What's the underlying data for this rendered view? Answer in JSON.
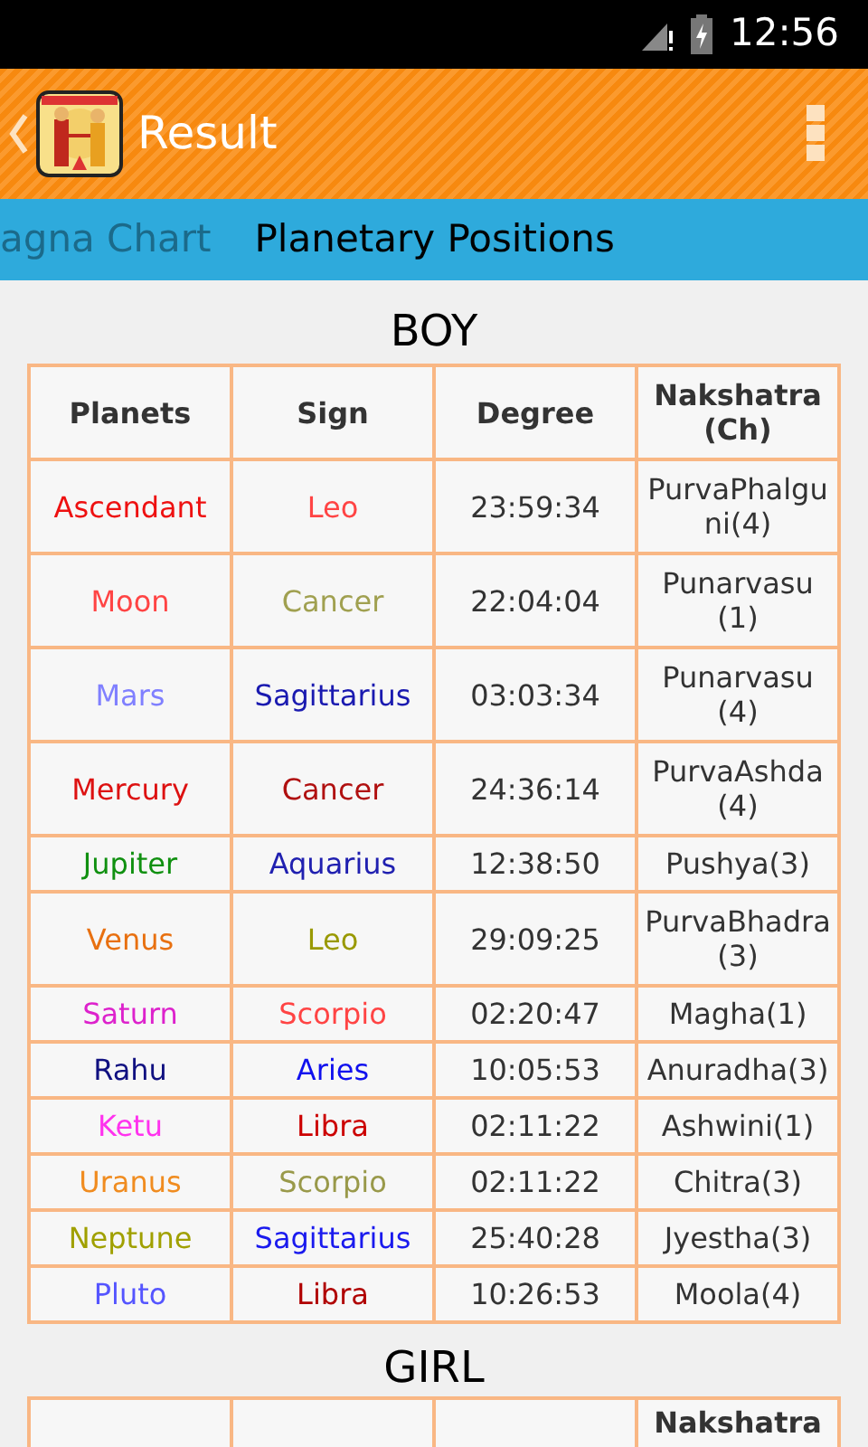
{
  "status_bar": {
    "time": "12:56"
  },
  "toolbar": {
    "title": "Result"
  },
  "tabs": [
    {
      "label": "agna Chart",
      "selected": false
    },
    {
      "label": "Planetary Positions",
      "selected": true
    }
  ],
  "sections": [
    {
      "heading": "BOY",
      "columns": [
        "Planets",
        "Sign",
        "Degree",
        "Nakshatra (Ch)"
      ],
      "rows": [
        {
          "planet": {
            "text": "Ascendant",
            "color": "#ee1111"
          },
          "sign": {
            "text": "Leo",
            "color": "#ff4444"
          },
          "degree": "23:59:34",
          "nakshatra": "PurvaPhalguni(4)"
        },
        {
          "planet": {
            "text": "Moon",
            "color": "#ff4444"
          },
          "sign": {
            "text": "Cancer",
            "color": "#a0a050"
          },
          "degree": "22:04:04",
          "nakshatra": "Punarvasu(1)"
        },
        {
          "planet": {
            "text": "Mars",
            "color": "#8080ff"
          },
          "sign": {
            "text": "Sagittarius",
            "color": "#1a1ab0"
          },
          "degree": "03:03:34",
          "nakshatra": "Punarvasu(4)"
        },
        {
          "planet": {
            "text": "Mercury",
            "color": "#dd1111"
          },
          "sign": {
            "text": "Cancer",
            "color": "#b01010"
          },
          "degree": "24:36:14",
          "nakshatra": "PurvaAshda(4)"
        },
        {
          "planet": {
            "text": "Jupiter",
            "color": "#109010"
          },
          "sign": {
            "text": "Aquarius",
            "color": "#2020b0"
          },
          "degree": "12:38:50",
          "nakshatra": "Pushya(3)"
        },
        {
          "planet": {
            "text": "Venus",
            "color": "#e87010"
          },
          "sign": {
            "text": "Leo",
            "color": "#999900"
          },
          "degree": "29:09:25",
          "nakshatra": "PurvaBhadra (3)"
        },
        {
          "planet": {
            "text": "Saturn",
            "color": "#dd22cc"
          },
          "sign": {
            "text": "Scorpio",
            "color": "#ff4444"
          },
          "degree": "02:20:47",
          "nakshatra": "Magha(1)"
        },
        {
          "planet": {
            "text": "Rahu",
            "color": "#101080"
          },
          "sign": {
            "text": "Aries",
            "color": "#1010ee"
          },
          "degree": "10:05:53",
          "nakshatra": "Anuradha(3)"
        },
        {
          "planet": {
            "text": "Ketu",
            "color": "#ff33ee"
          },
          "sign": {
            "text": "Libra",
            "color": "#cc0000"
          },
          "degree": "02:11:22",
          "nakshatra": "Ashwini(1)"
        },
        {
          "planet": {
            "text": "Uranus",
            "color": "#f08c20"
          },
          "sign": {
            "text": "Scorpio",
            "color": "#99994a"
          },
          "degree": "02:11:22",
          "nakshatra": "Chitra(3)"
        },
        {
          "planet": {
            "text": "Neptune",
            "color": "#a0a000"
          },
          "sign": {
            "text": "Sagittarius",
            "color": "#1a1aee"
          },
          "degree": "25:40:28",
          "nakshatra": "Jyestha(3)"
        },
        {
          "planet": {
            "text": "Pluto",
            "color": "#5555ff"
          },
          "sign": {
            "text": "Libra",
            "color": "#b00000"
          },
          "degree": "10:26:53",
          "nakshatra": "Moola(4)"
        }
      ]
    },
    {
      "heading": "GIRL",
      "columns": [
        "",
        "",
        "",
        "Nakshatra"
      ]
    }
  ]
}
